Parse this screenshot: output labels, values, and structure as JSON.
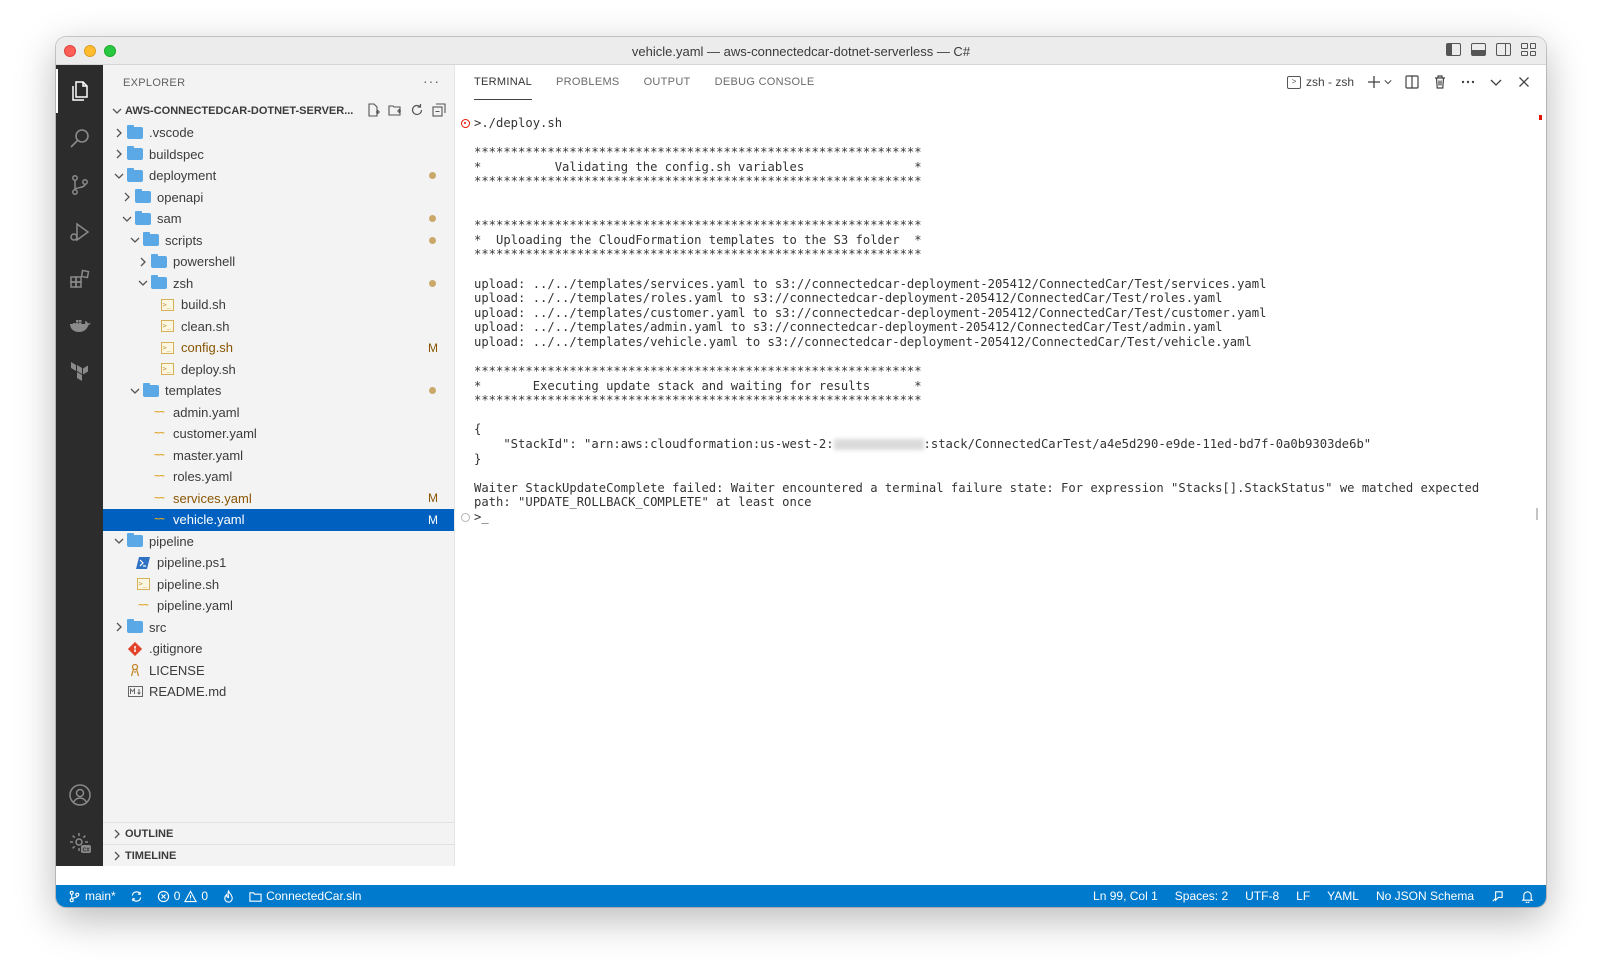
{
  "window": {
    "title": "vehicle.yaml — aws-connectedcar-dotnet-serverless — C#"
  },
  "explorer": {
    "header": "EXPLORER",
    "more": "···",
    "project": "AWS-CONNECTEDCAR-DOTNET-SERVER...",
    "tree": [
      {
        "label": ".vscode",
        "kind": "folder",
        "depth": 1,
        "expanded": false
      },
      {
        "label": "buildspec",
        "kind": "folder",
        "depth": 1,
        "expanded": false
      },
      {
        "label": "deployment",
        "kind": "folder",
        "depth": 1,
        "expanded": true,
        "modified_dot": true
      },
      {
        "label": "openapi",
        "kind": "folder",
        "depth": 2,
        "expanded": false
      },
      {
        "label": "sam",
        "kind": "folder",
        "depth": 2,
        "expanded": true,
        "modified_dot": true
      },
      {
        "label": "scripts",
        "kind": "folder",
        "depth": 3,
        "expanded": true,
        "modified_dot": true
      },
      {
        "label": "powershell",
        "kind": "folder",
        "depth": 4,
        "expanded": false
      },
      {
        "label": "zsh",
        "kind": "folder",
        "depth": 4,
        "expanded": true,
        "modified_dot": true
      },
      {
        "label": "build.sh",
        "kind": "sh",
        "depth": 5
      },
      {
        "label": "clean.sh",
        "kind": "sh",
        "depth": 5
      },
      {
        "label": "config.sh",
        "kind": "sh",
        "depth": 5,
        "badge": "M"
      },
      {
        "label": "deploy.sh",
        "kind": "sh",
        "depth": 5
      },
      {
        "label": "templates",
        "kind": "folder",
        "depth": 3,
        "expanded": true,
        "modified_dot": true
      },
      {
        "label": "admin.yaml",
        "kind": "yaml",
        "depth": 4
      },
      {
        "label": "customer.yaml",
        "kind": "yaml",
        "depth": 4
      },
      {
        "label": "master.yaml",
        "kind": "yaml",
        "depth": 4
      },
      {
        "label": "roles.yaml",
        "kind": "yaml",
        "depth": 4
      },
      {
        "label": "services.yaml",
        "kind": "yaml",
        "depth": 4,
        "badge": "M"
      },
      {
        "label": "vehicle.yaml",
        "kind": "yaml",
        "depth": 4,
        "badge": "M",
        "selected": true
      },
      {
        "label": "pipeline",
        "kind": "folder",
        "depth": 1,
        "expanded": true
      },
      {
        "label": "pipeline.ps1",
        "kind": "ps1",
        "depth": 2
      },
      {
        "label": "pipeline.sh",
        "kind": "sh",
        "depth": 2
      },
      {
        "label": "pipeline.yaml",
        "kind": "yaml",
        "depth": 2
      },
      {
        "label": "src",
        "kind": "folder",
        "depth": 1,
        "expanded": false
      },
      {
        "label": ".gitignore",
        "kind": "git",
        "depth": 1
      },
      {
        "label": "LICENSE",
        "kind": "license",
        "depth": 1
      },
      {
        "label": "README.md",
        "kind": "md",
        "depth": 1
      }
    ],
    "outline": "OUTLINE",
    "timeline": "TIMELINE"
  },
  "panel": {
    "tabs": [
      "TERMINAL",
      "PROBLEMS",
      "OUTPUT",
      "DEBUG CONSOLE"
    ],
    "active_tab": "TERMINAL",
    "terminal_name": "zsh - zsh",
    "lines": [
      ">./deploy.sh",
      "",
      "*************************************************************",
      "*          Validating the config.sh variables               *",
      "*************************************************************",
      "",
      "",
      "*************************************************************",
      "*  Uploading the CloudFormation templates to the S3 folder  *",
      "*************************************************************",
      "",
      "upload: ../../templates/services.yaml to s3://connectedcar-deployment-205412/ConnectedCar/Test/services.yaml",
      "upload: ../../templates/roles.yaml to s3://connectedcar-deployment-205412/ConnectedCar/Test/roles.yaml",
      "upload: ../../templates/customer.yaml to s3://connectedcar-deployment-205412/ConnectedCar/Test/customer.yaml",
      "upload: ../../templates/admin.yaml to s3://connectedcar-deployment-205412/ConnectedCar/Test/admin.yaml",
      "upload: ../../templates/vehicle.yaml to s3://connectedcar-deployment-205412/ConnectedCar/Test/vehicle.yaml",
      "",
      "*************************************************************",
      "*       Executing update stack and waiting for results      *",
      "*************************************************************",
      "",
      "{",
      "    \"StackId\": \"arn:aws:cloudformation:us-west-2:",
      "}",
      "",
      "Waiter StackUpdateComplete failed: Waiter encountered a terminal failure state: For expression \"Stacks[].StackStatus\" we matched expected",
      "path: \"UPDATE_ROLLBACK_COMPLETE\" at least once",
      ">_"
    ],
    "stack_id_suffix": ":stack/ConnectedCarTest/a4e5d290-e9de-11ed-bd7f-0a0b9303de6b\""
  },
  "statusbar": {
    "branch": "main*",
    "errors": "0",
    "warnings": "0",
    "solution": "ConnectedCar.sln",
    "position": "Ln 99, Col 1",
    "spaces": "Spaces: 2",
    "encoding": "UTF-8",
    "eol": "LF",
    "language": "YAML",
    "schema": "No JSON Schema",
    "color": "#007acc"
  }
}
